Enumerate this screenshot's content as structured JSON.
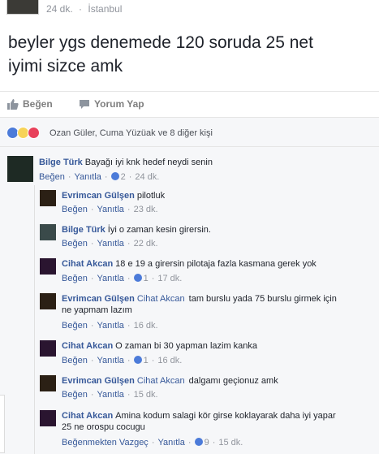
{
  "post": {
    "time": "24 dk.",
    "location": "İstanbul",
    "text_line1": "beyler ygs denemede 120 soruda 25 net",
    "text_line2": "iyimi sizce amk"
  },
  "actions": {
    "like_label": "Beğen",
    "comment_label": "Yorum Yap"
  },
  "reactions": {
    "text": "Ozan Güler, Cuma Yüzüak ve 8 diğer kişi"
  },
  "colors": {
    "link": "#365899",
    "meta": "#90949c",
    "like_blue": "#4c7bd9"
  },
  "comments": [
    {
      "name": "Bilge Türk",
      "tag": "",
      "text": "Bayağı iyi knk hedef neydi senin",
      "line2": "",
      "like": "Beğen",
      "reply": "Yanıtla",
      "likes": "2",
      "time": "24 dk."
    },
    {
      "name": "Evrimcan Gülşen",
      "tag": "",
      "text": "pilotluk",
      "line2": "",
      "like": "Beğen",
      "reply": "Yanıtla",
      "likes": "",
      "time": "23 dk."
    },
    {
      "name": "Bilge Türk",
      "tag": "",
      "text": "İyi o zaman kesin girersin.",
      "line2": "",
      "like": "Beğen",
      "reply": "Yanıtla",
      "likes": "",
      "time": "22 dk."
    },
    {
      "name": "Cihat Akcan",
      "tag": "",
      "text": "18 e 19 a girersin pilotaja fazla kasmana gerek yok",
      "line2": "",
      "like": "Beğen",
      "reply": "Yanıtla",
      "likes": "1",
      "time": "17 dk."
    },
    {
      "name": "Evrimcan Gülşen",
      "tag": "Cihat Akcan",
      "text": "tam burslu yada 75 burslu girmek için",
      "line2": "ne yapmam lazım",
      "like": "Beğen",
      "reply": "Yanıtla",
      "likes": "",
      "time": "16 dk."
    },
    {
      "name": "Cihat Akcan",
      "tag": "",
      "text": "O zaman bi 30 yapman lazim kanka",
      "line2": "",
      "like": "Beğen",
      "reply": "Yanıtla",
      "likes": "1",
      "time": "16 dk."
    },
    {
      "name": "Evrimcan Gülşen",
      "tag": "Cihat Akcan",
      "text": "dalgamı geçionuz amk",
      "line2": "",
      "like": "Beğen",
      "reply": "Yanıtla",
      "likes": "",
      "time": "15 dk."
    },
    {
      "name": "Cihat Akcan",
      "tag": "",
      "text": "Amina kodum salagi kör girse koklayarak daha iyi yapar",
      "line2": "25 ne orospu cocugu",
      "like": "Beğenmekten Vazgeç",
      "reply": "Yanıtla",
      "likes": "9",
      "time": "15 dk."
    }
  ]
}
